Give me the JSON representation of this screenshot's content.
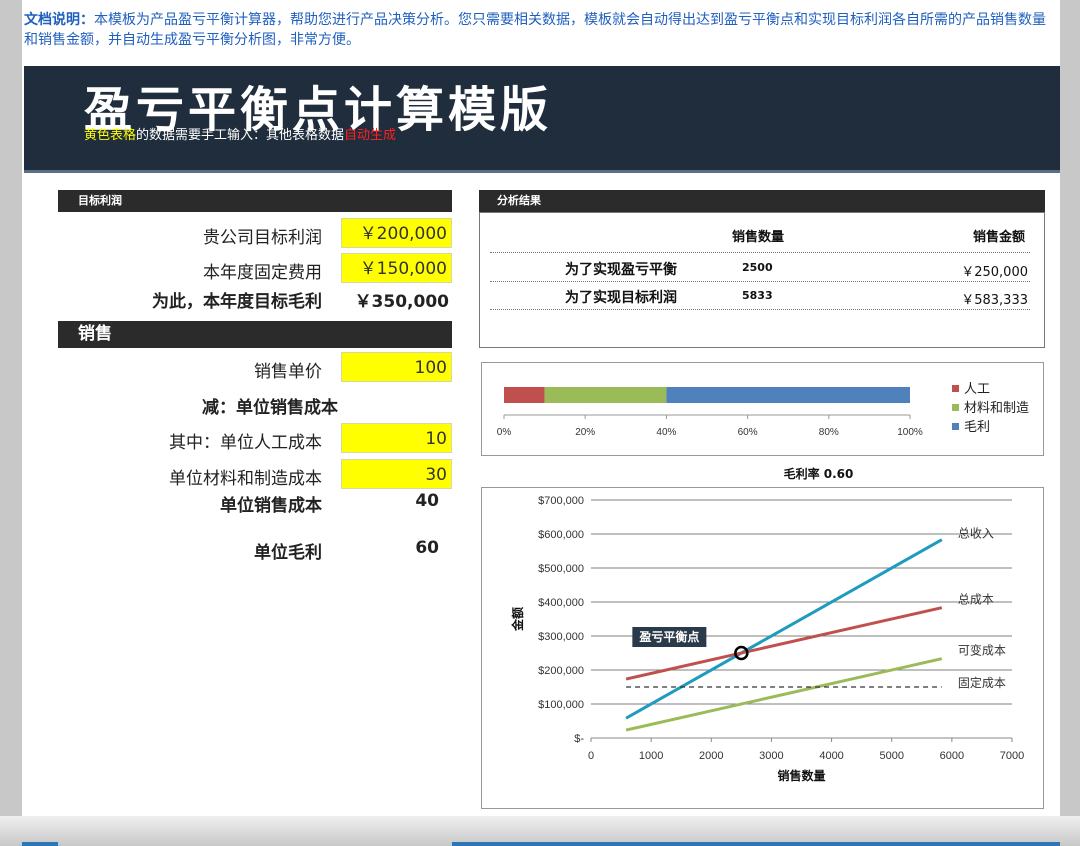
{
  "doc_note": {
    "label": "文档说明：",
    "text": "本模板为产品盈亏平衡计算器，帮助您进行产品决策分析。您只需要相关数据，模板就会自动得出达到盈亏平衡点和实现目标利润各自所需的产品销售数量和销售金额，并自动生成盈亏平衡分析图，非常方便。"
  },
  "header": {
    "title": "盈亏平衡点计算模版",
    "sub_yellow": "黄色表格",
    "sub_mid": "的数据需要手工输入：其他表格数据",
    "sub_red": "自动生成"
  },
  "target_section": {
    "heading": "目标利润",
    "rows": [
      {
        "label": "贵公司目标利润",
        "value": "￥200,000"
      },
      {
        "label": "本年度固定费用",
        "value": "￥150,000"
      },
      {
        "label": "为此，本年度目标毛利",
        "value": "￥350,000"
      }
    ]
  },
  "sales_section": {
    "heading": "销售",
    "unit_price_label": "销售单价",
    "unit_price": "100",
    "less_label": "减：单位销售成本",
    "labor_label": "其中：单位人工成本",
    "labor_value": "10",
    "material_label": "单位材料和制造成本",
    "material_value": "30",
    "unit_cost_label": "单位销售成本",
    "unit_cost_value": "40",
    "unit_margin_label": "单位毛利",
    "unit_margin_value": "60"
  },
  "analysis": {
    "heading": "分析结果",
    "col_qty": "销售数量",
    "col_amount": "销售金额",
    "rows": [
      {
        "label": "为了实现盈亏平衡",
        "qty": "2500",
        "amount": "￥250,000"
      },
      {
        "label": "为了实现目标利润",
        "qty": "5833",
        "amount": "￥583,333"
      }
    ]
  },
  "colors": {
    "labor": "#c0504d",
    "material": "#9bbb59",
    "margin": "#4f81bd",
    "revenue": "#1f9bbf",
    "total_cost": "#c0504d",
    "variable_cost": "#9bbb59",
    "fixed_cost": "#333333"
  },
  "chart_data": [
    {
      "type": "bar",
      "orientation": "horizontal-stacked-percent",
      "series": [
        {
          "name": "人工",
          "value": 10,
          "color": "#c0504d"
        },
        {
          "name": "材料和制造",
          "value": 30,
          "color": "#9bbb59"
        },
        {
          "name": "毛利",
          "value": 60,
          "color": "#4f81bd"
        }
      ],
      "xticks": [
        "0%",
        "20%",
        "40%",
        "60%",
        "80%",
        "100%"
      ],
      "xlim": [
        0,
        100
      ],
      "legend": "right"
    },
    {
      "type": "line",
      "title": "毛利率 0.60",
      "xlabel": "销售数量",
      "ylabel": "金额",
      "xlim": [
        0,
        7000
      ],
      "ylim": [
        0,
        700000
      ],
      "xticks": [
        "0",
        "1000",
        "2000",
        "3000",
        "4000",
        "5000",
        "6000",
        "7000"
      ],
      "yticks": [
        "$-",
        "$100,000",
        "$200,000",
        "$300,000",
        "$400,000",
        "$500,000",
        "$600,000",
        "$700,000"
      ],
      "grid": true,
      "series": [
        {
          "name": "总收入",
          "x": [
            583,
            5833
          ],
          "y": [
            58300,
            583300
          ],
          "color": "#1f9bbf",
          "dash": false
        },
        {
          "name": "总成本",
          "x": [
            583,
            5833
          ],
          "y": [
            173300,
            383300
          ],
          "color": "#c0504d",
          "dash": false
        },
        {
          "name": "可变成本",
          "x": [
            583,
            5833
          ],
          "y": [
            23300,
            233300
          ],
          "color": "#9bbb59",
          "dash": false
        },
        {
          "name": "固定成本",
          "x": [
            583,
            5833
          ],
          "y": [
            150000,
            150000
          ],
          "color": "#333333",
          "dash": true
        }
      ],
      "annotation": {
        "label": "盈亏平衡点",
        "x": 2500,
        "y": 250000
      }
    }
  ]
}
